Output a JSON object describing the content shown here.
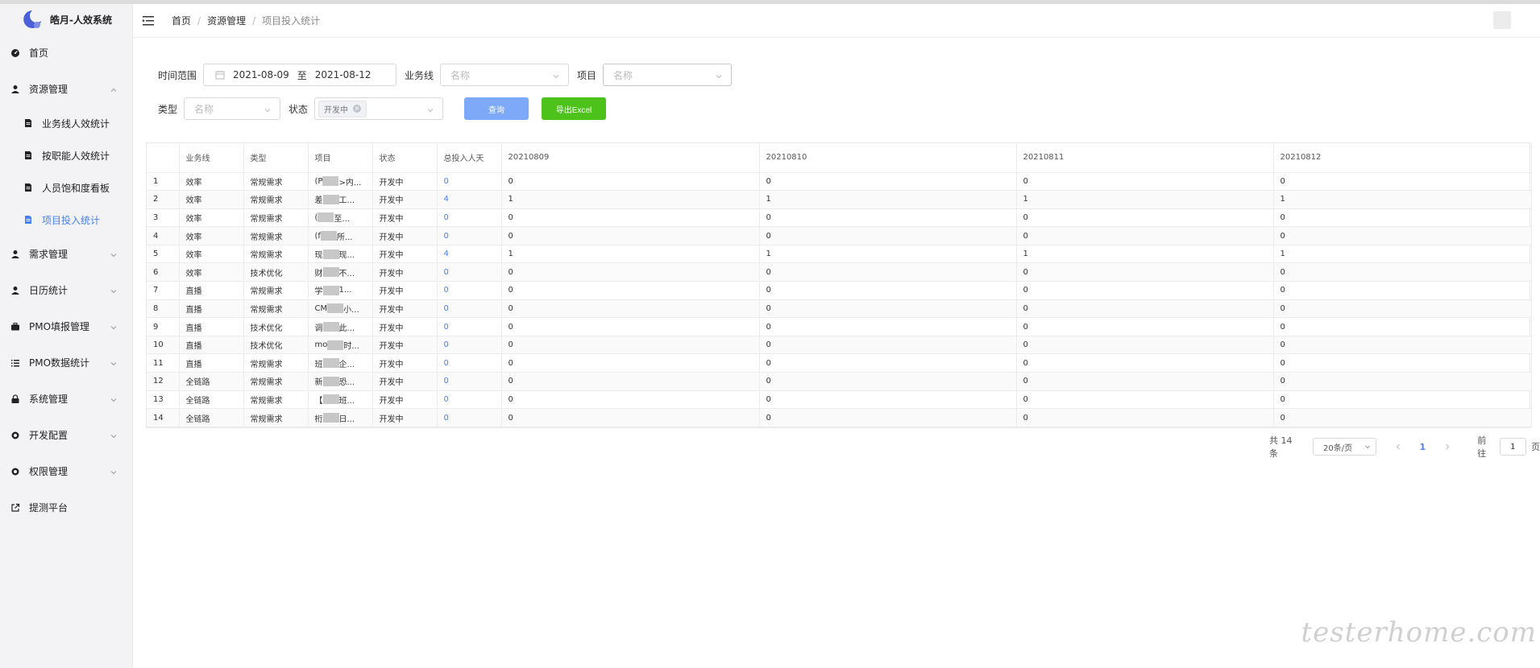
{
  "app": {
    "title": "皓月-人效系统",
    "brand_color": "#4a80f0"
  },
  "sidebar": {
    "items": [
      {
        "label": "首页",
        "icon": "dashboard-icon",
        "expandable": false
      },
      {
        "label": "资源管理",
        "icon": "user-icon",
        "expandable": true,
        "expanded": true,
        "children": [
          {
            "label": "业务线人效统计",
            "icon": "document-icon",
            "active": false
          },
          {
            "label": "按职能人效统计",
            "icon": "document-icon",
            "active": false
          },
          {
            "label": "人员饱和度看板",
            "icon": "document-icon",
            "active": false
          },
          {
            "label": "项目投入统计",
            "icon": "document-icon",
            "active": true
          }
        ]
      },
      {
        "label": "需求管理",
        "icon": "user-icon",
        "expandable": true
      },
      {
        "label": "日历统计",
        "icon": "user-icon",
        "expandable": true
      },
      {
        "label": "PMO填报管理",
        "icon": "briefcase-icon",
        "expandable": true
      },
      {
        "label": "PMO数据统计",
        "icon": "list-icon",
        "expandable": true
      },
      {
        "label": "系统管理",
        "icon": "lock-icon",
        "expandable": true
      },
      {
        "label": "开发配置",
        "icon": "settings-icon",
        "expandable": true
      },
      {
        "label": "权限管理",
        "icon": "settings-icon",
        "expandable": true
      },
      {
        "label": "提测平台",
        "icon": "external-link-icon",
        "expandable": false
      }
    ]
  },
  "breadcrumb": [
    "首页",
    "资源管理",
    "项目投入统计"
  ],
  "filters": {
    "time_label": "时间范围",
    "date_start": "2021-08-09",
    "date_sep": "至",
    "date_end": "2021-08-12",
    "business_label": "业务线",
    "business_placeholder": "名称",
    "project_label": "项目",
    "project_placeholder": "名称",
    "type_label": "类型",
    "type_placeholder": "名称",
    "status_label": "状态",
    "status_tag": "开发中",
    "query_button": "查询",
    "export_button": "导出Excel"
  },
  "table": {
    "columns": [
      "",
      "业务线",
      "类型",
      "项目",
      "状态",
      "总投入人天",
      "20210809",
      "20210810",
      "20210811",
      "20210812"
    ],
    "rows": [
      [
        "1",
        "效率",
        "常规需求",
        "(P",
        ">内...",
        "开发中",
        "0",
        "0",
        "0",
        "0",
        "0"
      ],
      [
        "2",
        "效率",
        "常规需求",
        "差",
        "工...",
        "开发中",
        "4",
        "1",
        "1",
        "1",
        "1"
      ],
      [
        "3",
        "效率",
        "常规需求",
        "(",
        "至...",
        "开发中",
        "0",
        "0",
        "0",
        "0",
        "0"
      ],
      [
        "4",
        "效率",
        "常规需求",
        "(f",
        "所...",
        "开发中",
        "0",
        "0",
        "0",
        "0",
        "0"
      ],
      [
        "5",
        "效率",
        "常规需求",
        "现",
        "现...",
        "开发中",
        "4",
        "1",
        "1",
        "1",
        "1"
      ],
      [
        "6",
        "效率",
        "技术优化",
        "财",
        "不...",
        "开发中",
        "0",
        "0",
        "0",
        "0",
        "0"
      ],
      [
        "7",
        "直播",
        "常规需求",
        "学",
        "1...",
        "开发中",
        "0",
        "0",
        "0",
        "0",
        "0"
      ],
      [
        "8",
        "直播",
        "常规需求",
        "CM",
        "小...",
        "开发中",
        "0",
        "0",
        "0",
        "0",
        "0"
      ],
      [
        "9",
        "直播",
        "技术优化",
        "调",
        "此...",
        "开发中",
        "0",
        "0",
        "0",
        "0",
        "0"
      ],
      [
        "10",
        "直播",
        "技术优化",
        "mo",
        "时...",
        "开发中",
        "0",
        "0",
        "0",
        "0",
        "0"
      ],
      [
        "11",
        "直播",
        "常规需求",
        "班",
        "企...",
        "开发中",
        "0",
        "0",
        "0",
        "0",
        "0"
      ],
      [
        "12",
        "全链路",
        "常规需求",
        "新",
        "恐...",
        "开发中",
        "0",
        "0",
        "0",
        "0",
        "0"
      ],
      [
        "13",
        "全链路",
        "常规需求",
        "【",
        "班...",
        "开发中",
        "0",
        "0",
        "0",
        "0",
        "0"
      ],
      [
        "14",
        "全链路",
        "常规需求",
        "桁",
        "日...",
        "开发中",
        "0",
        "0",
        "0",
        "0",
        "0"
      ]
    ]
  },
  "pagination": {
    "total": "共 14 条",
    "page_size": "20条/页",
    "current_page": "1",
    "goto_label": "前往",
    "goto_value": "1",
    "goto_suffix": "页"
  },
  "watermark": "testerhome.com"
}
